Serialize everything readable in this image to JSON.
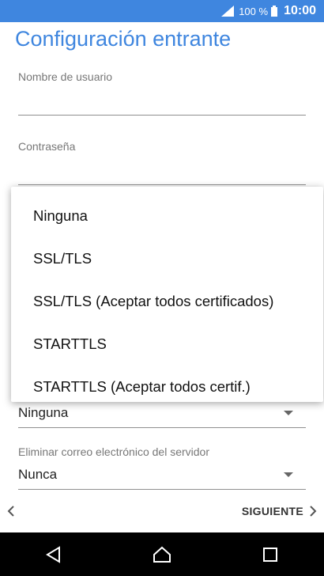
{
  "status_bar": {
    "battery_percent": "100 %",
    "time": "10:00",
    "icons": [
      "signal-icon",
      "battery-icon"
    ]
  },
  "page": {
    "title": "Configuración entrante"
  },
  "form": {
    "username_label": "Nombre de usuario",
    "username_value": "",
    "password_label": "Contraseña",
    "password_value": "",
    "security_selected": "Ninguna",
    "delete_label": "Eliminar correo electrónico del servidor",
    "delete_selected": "Nunca"
  },
  "dropdown": {
    "options": [
      "Ninguna",
      "SSL/TLS",
      "SSL/TLS (Aceptar todos certificados)",
      "STARTTLS",
      "STARTTLS (Aceptar todos certif.)"
    ]
  },
  "actions": {
    "next_label": "SIGUIENTE",
    "icons": [
      "chevron-left-icon",
      "chevron-right-icon"
    ]
  },
  "nav": {
    "icons": [
      "back-icon",
      "home-icon",
      "recents-icon"
    ]
  },
  "colors": {
    "accent": "#3f86df",
    "nav_background": "#000000"
  }
}
